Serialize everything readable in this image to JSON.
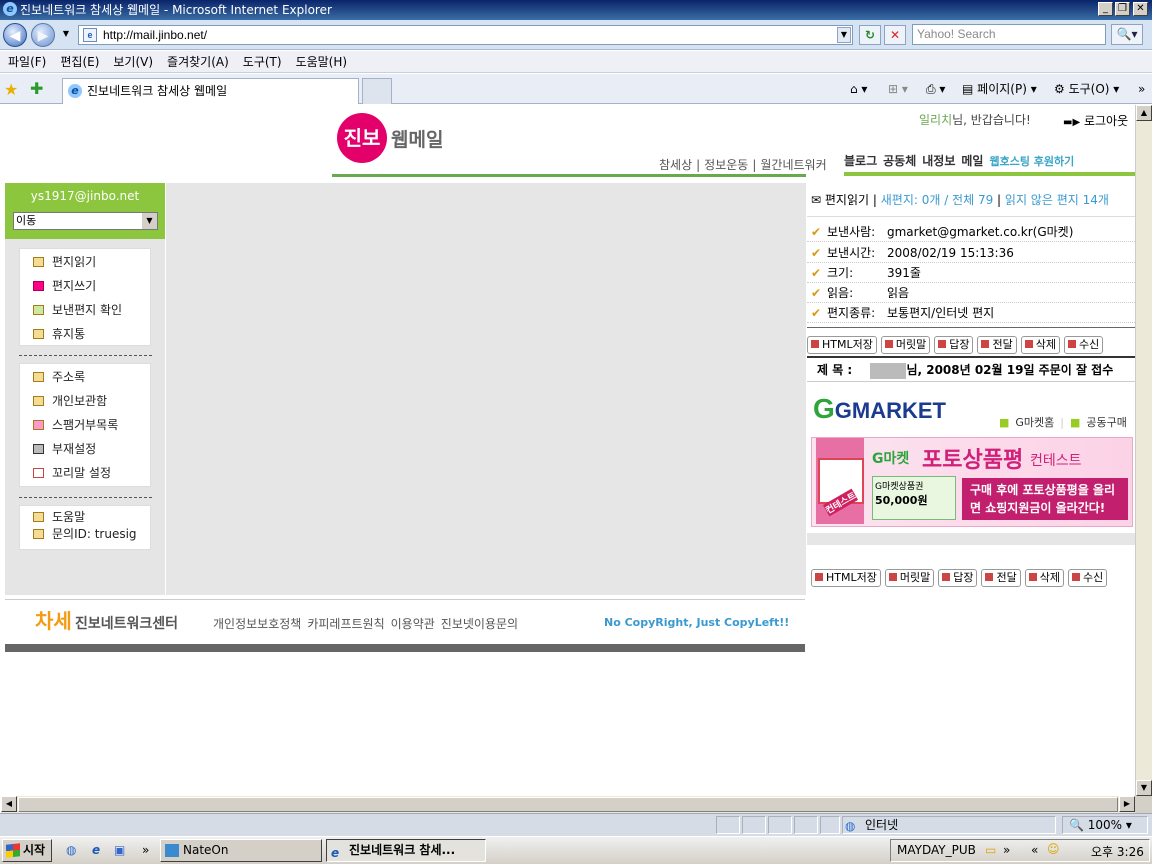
{
  "window": {
    "title": "진보네트워크 참세상 웹메일 - Microsoft Internet Explorer"
  },
  "browser": {
    "url": "http://mail.jinbo.net/",
    "search_placeholder": "Yahoo! Search",
    "menu": [
      "파일(F)",
      "편집(E)",
      "보기(V)",
      "즐겨찾기(A)",
      "도구(T)",
      "도움말(H)"
    ],
    "tab_title": "진보네트워크 참세상 웹메일",
    "toolbar_page": "페이지(P)",
    "toolbar_tools": "도구(O)",
    "status_zone": "인터넷",
    "zoom": "100%"
  },
  "site": {
    "logo_circle": "진보",
    "logo_text": "웹메일",
    "greeting_name": "일리치",
    "greeting_rest": "님, 반갑습니다!",
    "logout": "로그아웃",
    "topnav": [
      "참세상",
      "정보운동",
      "월간네트워커"
    ],
    "topnav2": [
      "블로그",
      "공동체",
      "내정보",
      "메일"
    ],
    "hosting_link": "웹호스팅 후원하기"
  },
  "sidebar": {
    "email": "ys1917@jinbo.net",
    "move_select": "이동",
    "group1": [
      "편지읽기",
      "편지쓰기",
      "보낸편지 확인",
      "휴지통"
    ],
    "group2": [
      "주소록",
      "개인보관함",
      "스팸거부목록",
      "부재설정",
      "꼬리말 설정"
    ],
    "group3": [
      "도움말",
      "문의ID: truesig"
    ]
  },
  "footer": {
    "logo_text": "진보네트워크센터",
    "links": [
      "개인정보보호정책",
      "카피레프트원칙",
      "이용약관",
      "진보넷이용문의"
    ],
    "copy": "No CopyRight, Just CopyLeft!!"
  },
  "mail": {
    "read_label": "편지읽기",
    "new_count": "새편지: 0개 / 전체 79",
    "unread": "읽지 않은 편지 14개",
    "fields": [
      {
        "label": "보낸사람:",
        "value": "gmarket@gmarket.co.kr(G마켓)"
      },
      {
        "label": "보낸시간:",
        "value": "2008/02/19 15:13:36"
      },
      {
        "label": "크기:",
        "value": "391줄"
      },
      {
        "label": "읽음:",
        "value": "읽음"
      },
      {
        "label": "편지종류:",
        "value": "보통편지/인터넷 편지"
      }
    ],
    "buttons": [
      "HTML저장",
      "머릿말",
      "답장",
      "전달",
      "삭제",
      "수신"
    ],
    "subject_label": "제 목 :",
    "subject": "님, 2008년 02월 19일 주문이 잘 접수",
    "gmarket_logo": "GMARKET",
    "gmarket_links": [
      "G마켓홈",
      "공동구매"
    ],
    "banner_brand": "G마켓",
    "banner_title": "포토상품평",
    "banner_suffix": "컨테스트",
    "banner_badge": "컨테스트",
    "banner_coupon": "G마켓상품권",
    "banner_amount": "50,000원",
    "banner_text": "구매 후에 포토상품평을 올리면 쇼핑지원금이 올라간다!"
  },
  "taskbar": {
    "start": "시작",
    "items": [
      "NateOn",
      "진보네트워크 참세..."
    ],
    "tray_label": "MAYDAY_PUB",
    "time": "오후 3:26"
  }
}
